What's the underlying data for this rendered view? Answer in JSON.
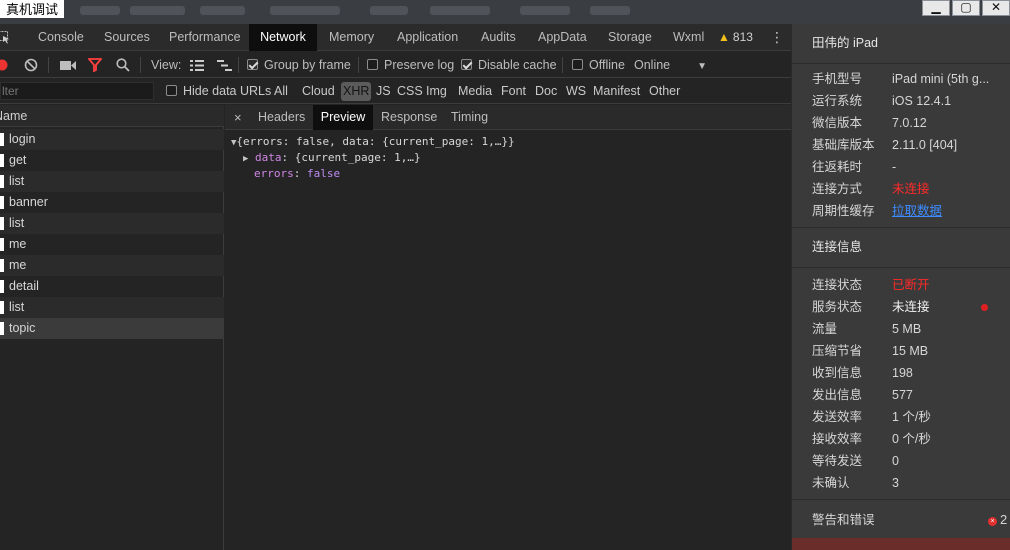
{
  "window": {
    "title": "真机调试"
  },
  "tabs": [
    "Console",
    "Sources",
    "Performance",
    "Network",
    "Memory",
    "Application",
    "Audits",
    "AppData",
    "Storage",
    "Wxml"
  ],
  "active_tab": "Network",
  "warnings_count": "813",
  "toolbar": {
    "view_label": "View:",
    "group_by_frame": "Group by frame",
    "preserve_log": "Preserve log",
    "disable_cache": "Disable cache",
    "offline": "Offline",
    "throttle": "Online"
  },
  "filter": {
    "placeholder": "Filter",
    "hide_data_urls": "Hide data URLs",
    "types": [
      "All",
      "Cloud",
      "XHR",
      "JS",
      "CSS",
      "Img",
      "Media",
      "Font",
      "Doc",
      "WS",
      "Manifest",
      "Other"
    ],
    "selected_type": "XHR"
  },
  "request_list": {
    "header": "Name",
    "rows": [
      "login",
      "get",
      "list",
      "banner",
      "list",
      "me",
      "me",
      "detail",
      "list",
      "topic"
    ],
    "selected_index": 9
  },
  "detail_tabs": [
    "Headers",
    "Preview",
    "Response",
    "Timing"
  ],
  "active_detail_tab": "Preview",
  "preview": {
    "root": "{errors: false, data: {current_page: 1,…}}",
    "data_key": "data",
    "data_val": "{current_page: 1,…}",
    "errors_key": "errors",
    "errors_val": "false"
  },
  "side_panel": {
    "device_title": "田伟的 iPad",
    "device_info": [
      {
        "label": "手机型号",
        "value": "iPad mini (5th g..."
      },
      {
        "label": "运行系统",
        "value": "iOS 12.4.1"
      },
      {
        "label": "微信版本",
        "value": "7.0.12"
      },
      {
        "label": "基础库版本",
        "value": "2.11.0 [404]"
      },
      {
        "label": "往返耗时",
        "value": "-"
      },
      {
        "label": "连接方式",
        "value": "未连接"
      },
      {
        "label": "周期性缓存",
        "value": "拉取数据"
      }
    ],
    "conn_title": "连接信息",
    "conn_info": [
      {
        "label": "连接状态",
        "value": "已断开"
      },
      {
        "label": "服务状态",
        "value": "未连接"
      },
      {
        "label": "流量",
        "value": "5 MB"
      },
      {
        "label": "压缩节省",
        "value": "15 MB"
      },
      {
        "label": "收到信息",
        "value": "198"
      },
      {
        "label": "发出信息",
        "value": "577"
      },
      {
        "label": "发送效率",
        "value": "1 个/秒"
      },
      {
        "label": "接收效率",
        "value": "0 个/秒"
      },
      {
        "label": "等待发送",
        "value": "0"
      },
      {
        "label": "未确认",
        "value": "3"
      }
    ],
    "errors_title": "警告和错误",
    "errors_count": "2"
  },
  "colors": {
    "error_red": "#ff2a2a",
    "link_blue": "#3d8cff",
    "warning_yellow": "#f3c11b"
  }
}
